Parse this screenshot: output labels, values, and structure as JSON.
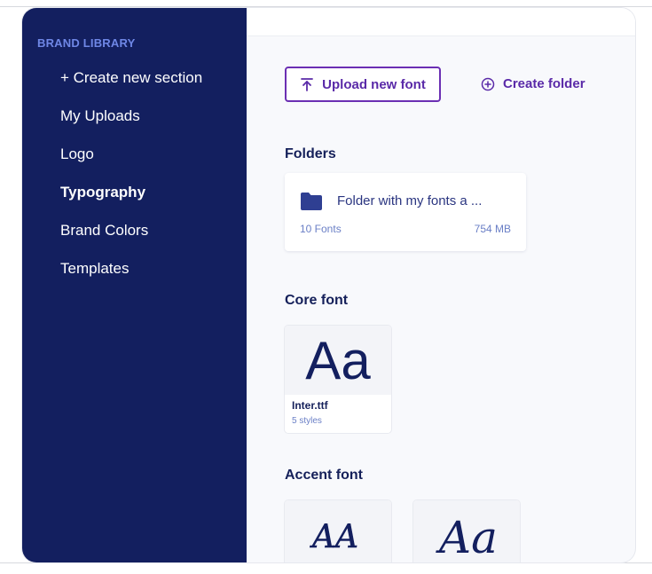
{
  "sidebar": {
    "title": "BRAND LIBRARY",
    "items": [
      {
        "label": "+ Create new section",
        "active": false
      },
      {
        "label": "My Uploads",
        "active": false
      },
      {
        "label": "Logo",
        "active": false
      },
      {
        "label": "Typography",
        "active": true
      },
      {
        "label": "Brand Colors",
        "active": false
      },
      {
        "label": "Templates",
        "active": false
      }
    ]
  },
  "toolbar": {
    "upload_label": "Upload new font",
    "create_folder_label": "Create folder"
  },
  "folders": {
    "title": "Folders",
    "items": [
      {
        "name": "Folder with my fonts a ...",
        "count": "10 Fonts",
        "size": "754 MB"
      }
    ]
  },
  "core_font": {
    "title": "Core font",
    "preview": "Aa",
    "name": "Inter.ttf",
    "styles": "5 styles"
  },
  "accent_font": {
    "title": "Accent font",
    "previews": [
      "AA",
      "Aa"
    ]
  },
  "colors": {
    "sidebar_bg": "#131f5f",
    "accent": "#6b2fb3",
    "label_blue": "#6f87e6"
  },
  "icons": [
    "upload-icon",
    "plus-circle-icon",
    "folder-icon"
  ]
}
